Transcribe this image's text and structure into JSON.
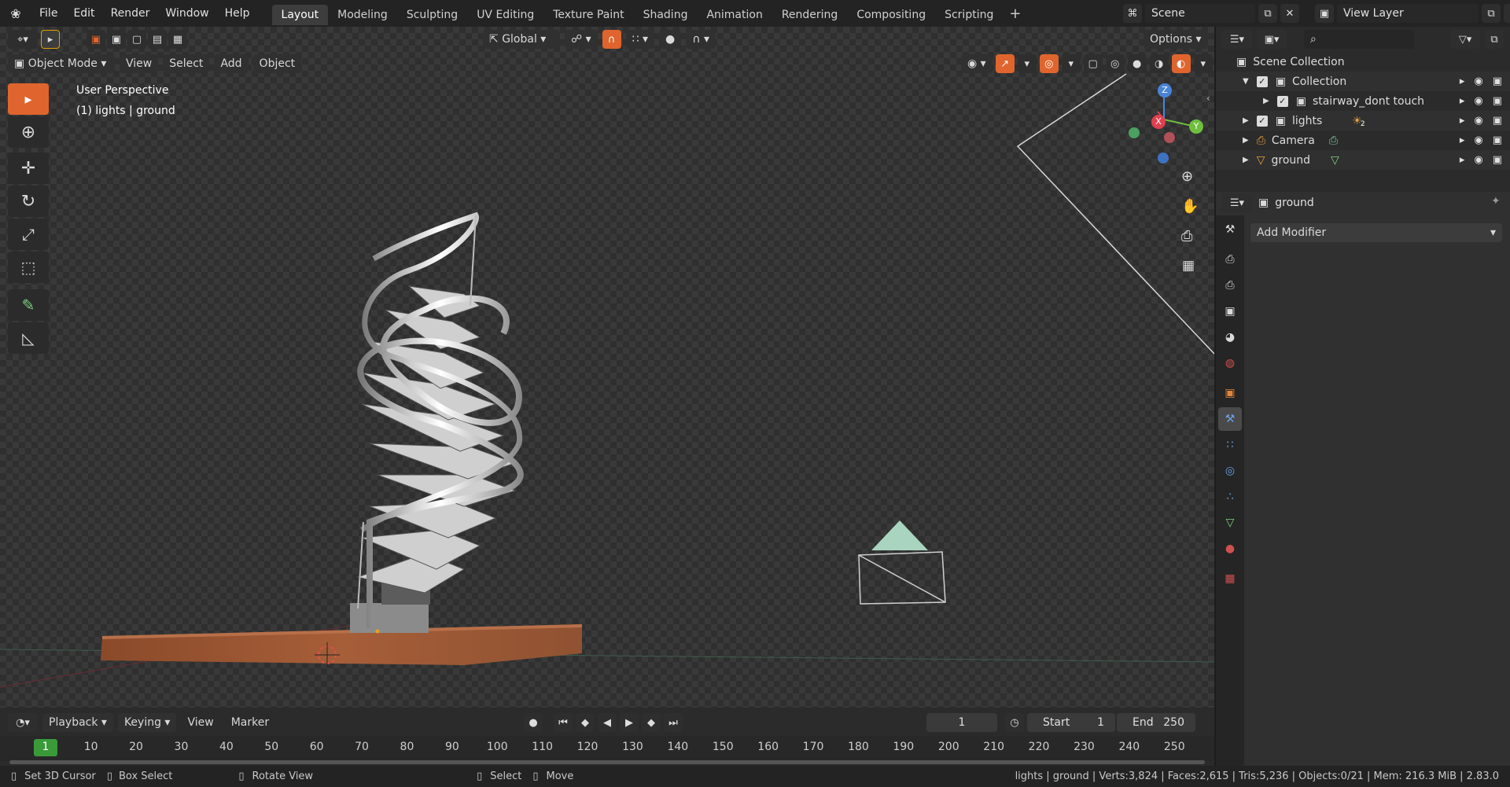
{
  "topbar": {
    "menus": [
      "File",
      "Edit",
      "Render",
      "Window",
      "Help"
    ],
    "workspaces": [
      "Layout",
      "Modeling",
      "Sculpting",
      "UV Editing",
      "Texture Paint",
      "Shading",
      "Animation",
      "Rendering",
      "Compositing",
      "Scripting"
    ],
    "active_workspace": "Layout",
    "scene": "Scene",
    "view_layer": "View Layer"
  },
  "toolbar": {
    "orientation": "Global",
    "options": "Options"
  },
  "viewport": {
    "mode": "Object Mode",
    "menus": [
      "View",
      "Select",
      "Add",
      "Object"
    ],
    "overlay_title": "User Perspective",
    "overlay_sub": "(1) lights | ground",
    "gizmo": {
      "x": "X",
      "y": "Y",
      "z": "Z"
    }
  },
  "outliner": {
    "search_placeholder": "",
    "items": [
      {
        "label": "Scene Collection"
      },
      {
        "label": "Collection"
      },
      {
        "label": "stairway_dont touch"
      },
      {
        "label": "lights",
        "badge": "2"
      },
      {
        "label": "Camera"
      },
      {
        "label": "ground"
      }
    ]
  },
  "properties": {
    "object_name": "ground",
    "add_modifier": "Add Modifier"
  },
  "timeline": {
    "menus": [
      "Playback",
      "Keying",
      "View",
      "Marker"
    ],
    "current_frame": "1",
    "start_label": "Start",
    "start": "1",
    "end_label": "End",
    "end": "250",
    "frames": [
      "1",
      "10",
      "20",
      "30",
      "40",
      "50",
      "60",
      "70",
      "80",
      "90",
      "100",
      "110",
      "120",
      "130",
      "140",
      "150",
      "160",
      "170",
      "180",
      "190",
      "200",
      "210",
      "220",
      "230",
      "240",
      "250"
    ]
  },
  "statusbar": {
    "hints": [
      "Set 3D Cursor",
      "Box Select",
      "Rotate View",
      "Select",
      "Move"
    ],
    "stats": "lights | ground | Verts:3,824 | Faces:2,615 | Tris:5,236 | Objects:0/21 | Mem: 216.3 MiB | 2.83.0"
  },
  "colors": {
    "accent": "#e0642d",
    "active_frame": "#3a9a3a",
    "x_axis": "#e0404f",
    "y_axis": "#6fbf3f",
    "z_axis": "#4a84d8"
  }
}
